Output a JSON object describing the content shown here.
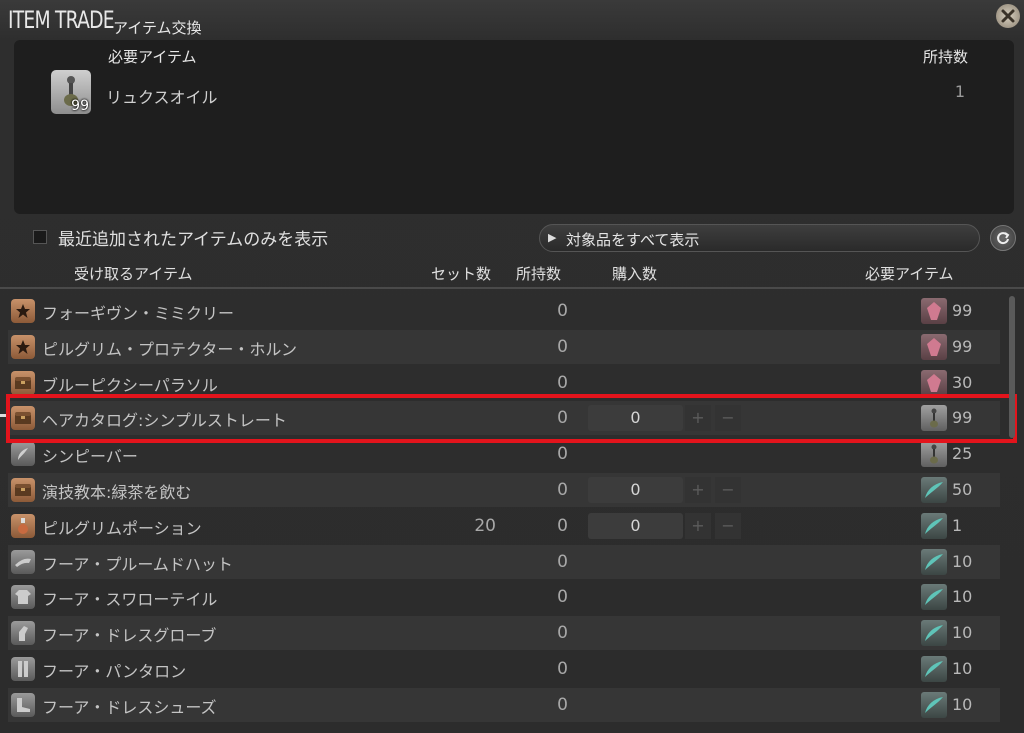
{
  "window": {
    "title_en": "ITEM TRADE",
    "title_jp": "アイテム交換",
    "accent": "#e3141c"
  },
  "required": {
    "header_item": "必要アイテム",
    "header_owned": "所持数",
    "item": {
      "icon": "oil-vial-icon",
      "qty": "99",
      "name": "リュクスオイル",
      "owned": "1"
    }
  },
  "filter": {
    "recent_only_label": "最近追加されたアイテムのみを表示",
    "dropdown_label": "対象品をすべて表示"
  },
  "columns": {
    "receive": "受け取るアイテム",
    "set_count": "セット数",
    "owned": "所持数",
    "purchase": "購入数",
    "required": "必要アイテム"
  },
  "rows": [
    {
      "name": "フォーギヴン・ミミクリー",
      "set": "",
      "owned": "0",
      "qty": null,
      "icon": "star-icon",
      "req_icon": "pink-crystal-icon",
      "req": "99"
    },
    {
      "name": "ピルグリム・プロテクター・ホルン",
      "set": "",
      "owned": "0",
      "qty": null,
      "icon": "star-icon",
      "req_icon": "pink-crystal-icon",
      "req": "99"
    },
    {
      "name": "ブルーピクシーパラソル",
      "set": "",
      "owned": "0",
      "qty": null,
      "icon": "chest-icon",
      "req_icon": "pink-crystal-icon",
      "req": "30"
    },
    {
      "name": "ヘアカタログ:シンプルストレート",
      "set": "",
      "owned": "0",
      "qty": "0",
      "icon": "chest-icon",
      "req_icon": "oil-vial-icon",
      "req": "99"
    },
    {
      "name": "シンピーバー",
      "set": "",
      "owned": "0",
      "qty": null,
      "icon": "feather-icon",
      "req_icon": "oil-vial-icon",
      "req": "25"
    },
    {
      "name": "演技教本:緑茶を飲む",
      "set": "",
      "owned": "0",
      "qty": "0",
      "icon": "chest-icon",
      "req_icon": "teal-feather-icon",
      "req": "50"
    },
    {
      "name": "ピルグリムポーション",
      "set": "20",
      "owned": "0",
      "qty": "0",
      "icon": "potion-icon",
      "req_icon": "teal-feather-icon",
      "req": "1"
    },
    {
      "name": "フーア・プルームドハット",
      "set": "",
      "owned": "0",
      "qty": null,
      "icon": "hat-icon",
      "req_icon": "teal-feather-icon",
      "req": "10"
    },
    {
      "name": "フーア・スワローテイル",
      "set": "",
      "owned": "0",
      "qty": null,
      "icon": "body-armor-icon",
      "req_icon": "teal-feather-icon",
      "req": "10"
    },
    {
      "name": "フーア・ドレスグローブ",
      "set": "",
      "owned": "0",
      "qty": null,
      "icon": "glove-icon",
      "req_icon": "teal-feather-icon",
      "req": "10"
    },
    {
      "name": "フーア・パンタロン",
      "set": "",
      "owned": "0",
      "qty": null,
      "icon": "legs-icon",
      "req_icon": "teal-feather-icon",
      "req": "10"
    },
    {
      "name": "フーア・ドレスシューズ",
      "set": "",
      "owned": "0",
      "qty": null,
      "icon": "boots-icon",
      "req_icon": "teal-feather-icon",
      "req": "10"
    }
  ]
}
